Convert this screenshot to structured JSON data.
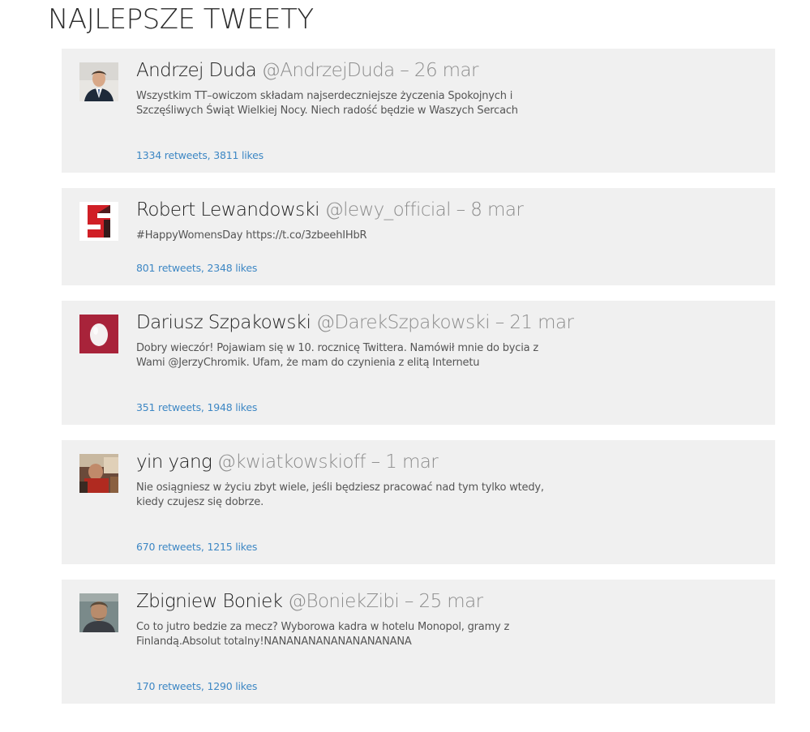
{
  "page": {
    "title": "NAJLEPSZE TWEETY"
  },
  "tweets": [
    {
      "name": "Andrzej Duda",
      "handle": "@AndrzejDuda",
      "separator": "–",
      "date": "26 mar",
      "text": "Wszystkim TT–owiczom składam najserdeczniejsze życzenia Spokojnych i Szczęśliwych Świąt Wielkiej Nocy. Niech radość będzie w Waszych Sercach",
      "stats": "1334 retweets, 3811 likes",
      "avatar_icon": "person-suit-avatar-icon"
    },
    {
      "name": "Robert Lewandowski",
      "handle": "@lewy_official",
      "separator": "–",
      "date": "8 mar",
      "text": "#HappyWomensDay https://t.co/3zbeehIHbR",
      "stats": "801 retweets, 2348 likes",
      "avatar_icon": "rl9-logo-avatar-icon"
    },
    {
      "name": "Dariusz Szpakowski",
      "handle": "@DarekSzpakowski",
      "separator": "–",
      "date": "21 mar",
      "text": "Dobry wieczór! Pojawiam się w 10. rocznicę Twittera. Namówił mnie do bycia z Wami @JerzyChromik. Ufam, że mam do czynienia z elitą Internetu",
      "stats": "351 retweets, 1948 likes",
      "avatar_icon": "egg-avatar-icon"
    },
    {
      "name": "yin yang",
      "handle": "@kwiatkowskioff",
      "separator": "–",
      "date": "1 mar",
      "text": "Nie osiągniesz w życiu zbyt wiele, jeśli będziesz pracować nad tym tylko wtedy, kiedy czujesz się dobrze.",
      "stats": "670 retweets, 1215 likes",
      "avatar_icon": "photo-avatar-icon"
    },
    {
      "name": "Zbigniew Boniek",
      "handle": "@BoniekZibi",
      "separator": "–",
      "date": "25 mar",
      "text": "Co to jutro bedzie za mecz? Wyborowa kadra w hotelu Monopol, gramy z Finlandą.Absolut totalny!NANANANANANANANANANA",
      "stats": "170 retweets, 1290 likes",
      "avatar_icon": "person-portrait-avatar-icon"
    }
  ],
  "colors": {
    "card_background": "#f0f0f0",
    "link": "#3d87c4",
    "muted": "#8c8c8c",
    "egg_background": "#a8233a"
  }
}
